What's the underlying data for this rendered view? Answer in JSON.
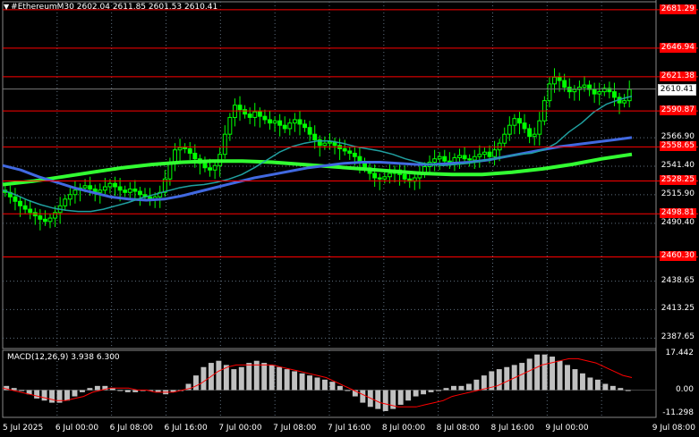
{
  "header": {
    "symbol_line": "#EthereumM30  2602.04 2611.85 2601.53 2610.41"
  },
  "levels": [
    {
      "price": 2681.29,
      "label": "2681.29"
    },
    {
      "price": 2646.94,
      "label": "2646.94"
    },
    {
      "price": 2621.38,
      "label": "2621.38"
    },
    {
      "price": 2590.87,
      "label": "2590.87"
    },
    {
      "price": 2558.65,
      "label": "2558.65"
    },
    {
      "price": 2528.25,
      "label": "2528.25"
    },
    {
      "price": 2498.81,
      "label": "2498.81"
    },
    {
      "price": 2460.3,
      "label": "2460.30"
    }
  ],
  "price_axis": {
    "ticks": [
      "2566.90",
      "2541.40",
      "2515.90",
      "2490.40",
      "2438.65",
      "2413.25",
      "2387.65"
    ],
    "tick_values": [
      2566.9,
      2541.4,
      2515.9,
      2490.4,
      2438.65,
      2413.25,
      2387.65
    ],
    "hidden_ticks": [
      "2644.45",
      "2618.95",
      "2592.65",
      "2464.15"
    ],
    "current_price": "2610.41",
    "current_value": 2610.41,
    "range": [
      2380,
      2690
    ]
  },
  "time_axis": {
    "labels": [
      "5 Jul 2025",
      "6 Jul 00:00",
      "6 Jul 08:00",
      "6 Jul 16:00",
      "7 Jul 00:00",
      "7 Jul 08:00",
      "7 Jul 16:00",
      "8 Jul 00:00",
      "8 Jul 08:00",
      "8 Jul 16:00",
      "9 Jul 00:00",
      "9 Jul 08:00"
    ]
  },
  "macd": {
    "title": "MACD(12,26,9)",
    "macd_value": "3.938",
    "signal_value": "6.300",
    "axis_labels": [
      "17.442",
      "0.00",
      "-11.298"
    ],
    "axis_values": [
      17.442,
      0,
      -11.298
    ]
  },
  "colors": {
    "background": "#000000",
    "candle": "#00ff00",
    "level_line": "#ff0000",
    "ma_fast": "#20a0a0",
    "ma_mid": "#4169e1",
    "ma_slow": "#32ff32",
    "macd_hist": "#c0c0c0",
    "macd_signal": "#ff0000",
    "grid": "#607080"
  },
  "chart_data": {
    "type": "candlestick",
    "symbol": "#Ethereum",
    "timeframe": "M30",
    "close_series": [
      2518,
      2514,
      2510,
      2506,
      2503,
      2500,
      2497,
      2494,
      2492,
      2495,
      2500,
      2506,
      2512,
      2516,
      2520,
      2522,
      2524,
      2521,
      2518,
      2520,
      2523,
      2526,
      2523,
      2520,
      2518,
      2521,
      2519,
      2516,
      2514,
      2512,
      2514,
      2518,
      2530,
      2545,
      2556,
      2558,
      2557,
      2553,
      2548,
      2544,
      2540,
      2538,
      2542,
      2552,
      2570,
      2585,
      2596,
      2592,
      2588,
      2585,
      2590,
      2586,
      2583,
      2580,
      2582,
      2578,
      2575,
      2580,
      2583,
      2579,
      2576,
      2570,
      2565,
      2560,
      2562,
      2563,
      2560,
      2557,
      2555,
      2553,
      2550,
      2545,
      2540,
      2535,
      2531,
      2530,
      2532,
      2535,
      2538,
      2534,
      2530,
      2528,
      2531,
      2535,
      2541,
      2545,
      2548,
      2550,
      2546,
      2545,
      2549,
      2551,
      2548,
      2547,
      2550,
      2552,
      2554,
      2550,
      2556,
      2562,
      2570,
      2578,
      2584,
      2580,
      2575,
      2568,
      2570,
      2582,
      2600,
      2615,
      2621,
      2618,
      2612,
      2608,
      2610,
      2612,
      2614,
      2610,
      2606,
      2608,
      2611,
      2608,
      2603,
      2598,
      2600,
      2610
    ],
    "ma_fast": [
      2520,
      2516,
      2511,
      2507,
      2504,
      2502,
      2501,
      2501,
      2503,
      2506,
      2509,
      2513,
      2516,
      2519,
      2522,
      2524,
      2525,
      2527,
      2530,
      2534,
      2540,
      2547,
      2554,
      2559,
      2562,
      2564,
      2564,
      2562,
      2559,
      2557,
      2555,
      2552,
      2548,
      2545,
      2543,
      2542,
      2543,
      2544,
      2546,
      2548,
      2550,
      2552,
      2553,
      2556,
      2562,
      2572,
      2580,
      2590,
      2597,
      2601,
      2604
    ],
    "ma_mid": [
      2542,
      2538,
      2532,
      2527,
      2522,
      2518,
      2514,
      2512,
      2511,
      2512,
      2515,
      2519,
      2523,
      2527,
      2531,
      2534,
      2537,
      2540,
      2542,
      2544,
      2545,
      2545,
      2544,
      2543,
      2543,
      2544,
      2545,
      2547,
      2550,
      2553,
      2556,
      2559,
      2561,
      2563,
      2565,
      2567
    ],
    "ma_slow": [
      2525,
      2528,
      2532,
      2536,
      2540,
      2543,
      2545,
      2546,
      2546,
      2545,
      2543,
      2541,
      2539,
      2537,
      2535,
      2534,
      2534,
      2536,
      2539,
      2543,
      2548,
      2552
    ],
    "macd_hist": [
      2,
      1,
      0,
      -2,
      -4,
      -5,
      -6,
      -6,
      -5,
      -3,
      -1,
      1,
      2,
      2,
      1,
      0,
      -1,
      -1,
      0,
      0,
      -1,
      -2,
      -1,
      0,
      3,
      7,
      11,
      13,
      14,
      12,
      10,
      11,
      13,
      14,
      13,
      12,
      11,
      10,
      9,
      8,
      7,
      6,
      5,
      4,
      2,
      0,
      -3,
      -6,
      -8,
      -9,
      -10,
      -9,
      -7,
      -5,
      -3,
      -2,
      -1,
      0,
      1,
      2,
      2,
      3,
      5,
      7,
      9,
      10,
      11,
      12,
      13,
      15,
      17,
      17,
      16,
      14,
      12,
      10,
      8,
      6,
      5,
      3,
      2,
      1,
      0
    ],
    "macd_signal": [
      1,
      0,
      -1,
      -2,
      -3,
      -4,
      -5,
      -5,
      -4,
      -3,
      -1,
      0,
      1,
      1,
      1,
      0,
      0,
      -1,
      -1,
      -1,
      0,
      1,
      3,
      6,
      9,
      11,
      12,
      12,
      12,
      12,
      12,
      11,
      10,
      9,
      8,
      7,
      6,
      4,
      2,
      0,
      -2,
      -4,
      -6,
      -7,
      -8,
      -8,
      -8,
      -7,
      -6,
      -5,
      -3,
      -2,
      -1,
      0,
      1,
      2,
      4,
      6,
      8,
      10,
      12,
      13,
      14,
      15,
      15,
      14,
      13,
      11,
      9,
      7,
      6
    ]
  }
}
